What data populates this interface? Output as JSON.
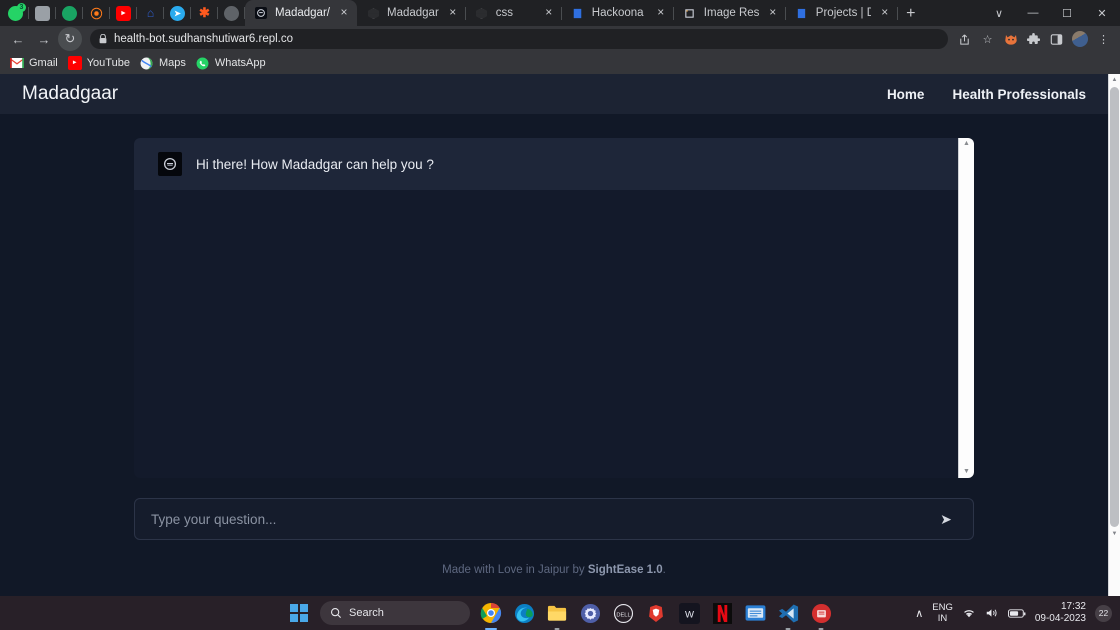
{
  "browser": {
    "pinned_tabs": [
      {
        "name": "whatsapp",
        "color": "#25d366",
        "glyph": "",
        "badge": "3"
      },
      {
        "name": "gray-app",
        "color": "#9aa0a6",
        "glyph": ""
      },
      {
        "name": "green-app",
        "color": "#1db954",
        "glyph": ""
      },
      {
        "name": "orange-app",
        "color": "#ff7a1a",
        "glyph": ""
      },
      {
        "name": "youtube",
        "color": "#ff0000",
        "glyph": "▶"
      },
      {
        "name": "blue-glyph-app",
        "color": "#1a3b8f",
        "glyph": ""
      },
      {
        "name": "telegram",
        "color": "#2aabee",
        "glyph": "➤"
      },
      {
        "name": "asterisk-app",
        "color": "#ff5a1f",
        "glyph": "✱"
      },
      {
        "name": "gray-circle-app",
        "color": "#6e7378",
        "glyph": ""
      }
    ],
    "tabs": [
      {
        "title": "Madadgar/Healt",
        "active": true,
        "favicon": "bot-icon"
      },
      {
        "title": "Madadgar",
        "active": false,
        "favicon": "globe-icon"
      },
      {
        "title": "css",
        "active": false,
        "favicon": "globe-icon"
      },
      {
        "title": "Hackoona Matat",
        "active": false,
        "favicon": "blue-doc-icon"
      },
      {
        "title": "Image Resizer",
        "active": false,
        "favicon": "crop-icon"
      },
      {
        "title": "Projects | Devfol",
        "active": false,
        "favicon": "blue-doc-icon"
      }
    ],
    "new_tab_label": "+",
    "close_label": "×",
    "window_controls": {
      "list": "∨",
      "minimize": "—",
      "maximize": "☐",
      "close": "✕"
    },
    "nav": {
      "back": "←",
      "forward": "→",
      "reload": "↻"
    },
    "url": "health-bot.sudhanshutiwar6.repl.co",
    "lock_icon": "🔒",
    "omni_icons": [
      {
        "name": "share-icon",
        "glyph": "↱"
      },
      {
        "name": "bookmark-star-icon",
        "glyph": "☆"
      },
      {
        "name": "fox-extension-icon",
        "glyph": ""
      },
      {
        "name": "extensions-puzzle-icon",
        "glyph": "✦"
      },
      {
        "name": "side-panel-icon",
        "glyph": "◱"
      }
    ],
    "menu_icon": "⋮",
    "bookmarks": [
      {
        "label": "Gmail",
        "color": "#ea4335",
        "glyph": "M"
      },
      {
        "label": "YouTube",
        "color": "#ff0000",
        "glyph": "▶"
      },
      {
        "label": "Maps",
        "color": "#34a853",
        "glyph": "◉"
      },
      {
        "label": "WhatsApp",
        "color": "#25d366",
        "glyph": "☎"
      }
    ]
  },
  "site": {
    "brand": "Madadgaar",
    "nav": [
      {
        "label": "Home"
      },
      {
        "label": "Health Professionals"
      }
    ],
    "chat": {
      "messages": [
        {
          "sender": "bot",
          "text": "Hi there! How Madadgar can help you ?"
        }
      ],
      "scroll_up_arrow": "▲",
      "scroll_down_arrow": "▼"
    },
    "input": {
      "value": "",
      "placeholder": "Type your question...",
      "send_icon": "➤"
    },
    "footer": {
      "prefix": "Made with Love in Jaipur by ",
      "brand": "SightEase 1.0",
      "suffix": "."
    },
    "colors": {
      "page_bg": "#111827",
      "header_bg": "#1c2333",
      "chat_bg": "#131a2b",
      "message_bg": "#1e2639"
    }
  },
  "taskbar": {
    "start_label": "⊞",
    "search_placeholder": "Search",
    "search_icon": "⌕",
    "apps": [
      {
        "name": "chrome",
        "color": "#f4b400",
        "glyph": "",
        "state": "active"
      },
      {
        "name": "edge",
        "color": "#0f8fd8",
        "glyph": "",
        "state": "none"
      },
      {
        "name": "file-explorer",
        "color": "#f6c344",
        "glyph": "",
        "state": "running"
      },
      {
        "name": "settings-gear",
        "color": "#5c6aa8",
        "glyph": "⚙",
        "state": "none"
      },
      {
        "name": "dell",
        "color": "#1a1a1a",
        "glyph": "D",
        "state": "none"
      },
      {
        "name": "brave-shield",
        "color": "#e03a2f",
        "glyph": "▼",
        "state": "none"
      },
      {
        "name": "w-app",
        "color": "#1b1b2a",
        "glyph": "W",
        "state": "none"
      },
      {
        "name": "netflix",
        "color": "#0b0b0b",
        "glyph": "N",
        "state": "none"
      },
      {
        "name": "blue-app",
        "color": "#2b7fd4",
        "glyph": "⌨",
        "state": "none"
      },
      {
        "name": "vscode",
        "color": "#1f6fb2",
        "glyph": "✕",
        "state": "running"
      },
      {
        "name": "red-app",
        "color": "#d32f2f",
        "glyph": "",
        "state": "running"
      }
    ],
    "tray": {
      "chevron": "∧",
      "language_line1": "ENG",
      "language_line2": "IN",
      "wifi_icon": "◠",
      "volume_icon": "🔊",
      "battery_icon": "▭",
      "time": "17:32",
      "date": "09-04-2023",
      "notification_count": "22"
    }
  }
}
